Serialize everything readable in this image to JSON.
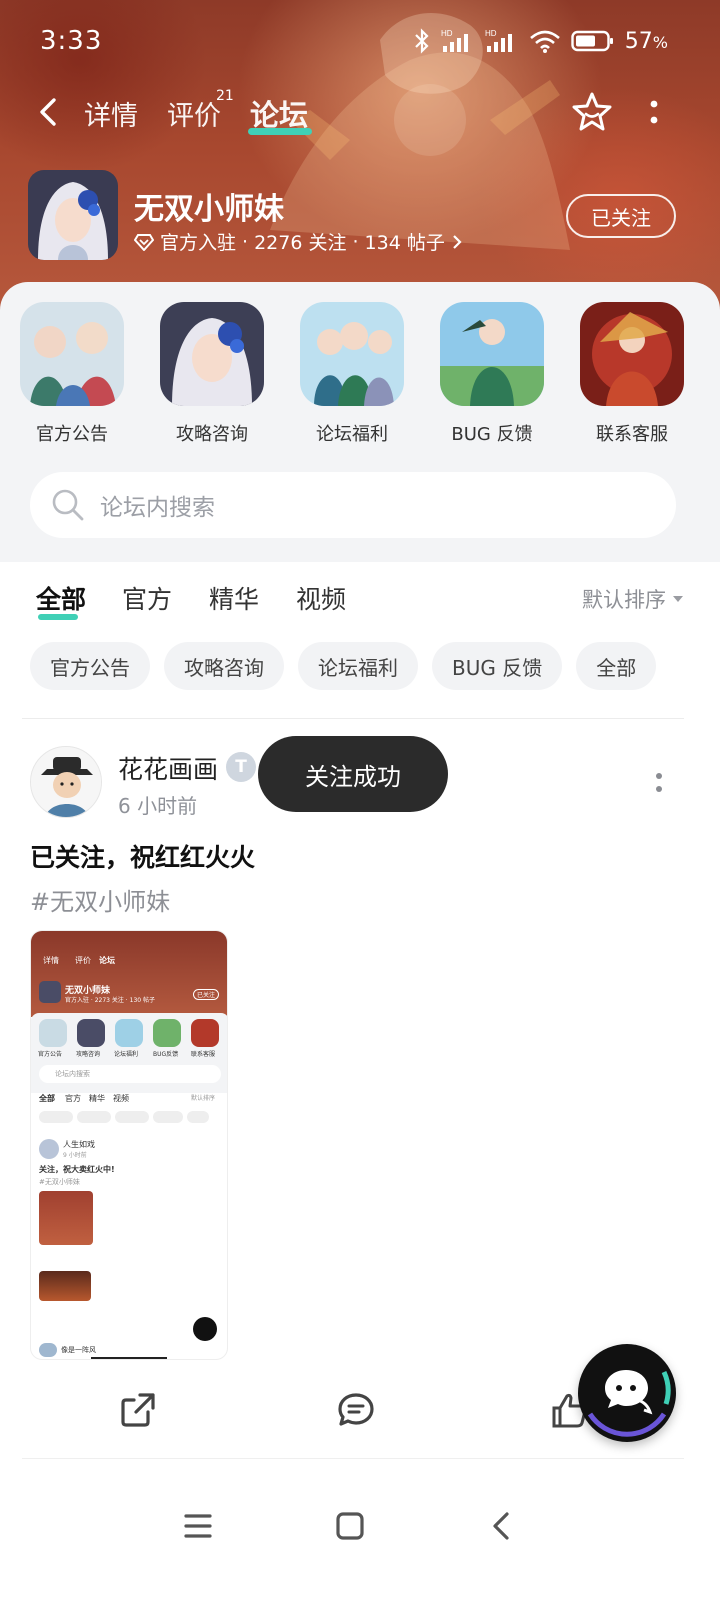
{
  "status_bar": {
    "time": "3:33",
    "battery_percent": "57",
    "battery_unit": "%"
  },
  "nav": {
    "tabs": [
      {
        "label": "详情"
      },
      {
        "label": "评价",
        "badge": "21"
      },
      {
        "label": "论坛"
      }
    ],
    "active_tab": "论坛"
  },
  "forum": {
    "name": "无双小师妹",
    "official": "官方入驻",
    "followers": "2276 关注",
    "posts": "134 帖子",
    "follow_state": "已关注"
  },
  "categories": [
    {
      "label": "官方公告"
    },
    {
      "label": "攻略咨询"
    },
    {
      "label": "论坛福利"
    },
    {
      "label": "BUG 反馈"
    },
    {
      "label": "联系客服"
    }
  ],
  "search": {
    "placeholder": "论坛内搜索"
  },
  "filter_tabs": [
    {
      "label": "全部"
    },
    {
      "label": "官方"
    },
    {
      "label": "精华"
    },
    {
      "label": "视频"
    }
  ],
  "sort_label": "默认排序",
  "chips": [
    {
      "label": "官方公告"
    },
    {
      "label": "攻略咨询"
    },
    {
      "label": "论坛福利"
    },
    {
      "label": "BUG 反馈"
    },
    {
      "label": "全部"
    }
  ],
  "post": {
    "user": "花花画画",
    "badge": "T",
    "time": "6 小时前",
    "title": "已关注，祝红红火火",
    "tag": "#无双小师妹"
  },
  "toast": "关注成功",
  "mini_screenshot": {
    "tabs": [
      "详情",
      "评价",
      "论坛"
    ],
    "forum_name": "无双小师妹",
    "follow": "已关注",
    "meta": "官方入驻 · 2273 关注 · 130 帖子",
    "cats": [
      "官方公告",
      "攻略咨询",
      "论坛福利",
      "BUG反馈",
      "联系客服"
    ],
    "search": "论坛内搜索",
    "tabs2": [
      "全部",
      "官方",
      "精华",
      "视频"
    ],
    "sort": "默认排序",
    "post_user": "人生如戏",
    "post_time": "9 小时前",
    "post_title": "关注，祝大卖红火中!",
    "post_tag": "#无双小师妹",
    "next_user": "像是一阵风"
  },
  "colors": {
    "accent": "#3fd0b6",
    "banner": "#a8482f",
    "toast_bg": "#2b2b2b"
  }
}
